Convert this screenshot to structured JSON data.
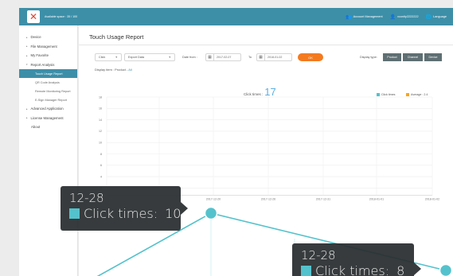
{
  "header": {
    "app_title": "Available space : 35 / 100",
    "account_management": "Account Management",
    "user": "vconity2222222",
    "language": "Language"
  },
  "sidebar": {
    "items": [
      {
        "label": "Device"
      },
      {
        "label": "File Management"
      },
      {
        "label": "My Favorite"
      },
      {
        "label": "Report Analysis"
      }
    ],
    "report_sub": [
      "Touch Usage Report",
      "QR Code Analysis",
      "Remote Monitoring Report",
      "E-Sign Manager Report"
    ],
    "items_after": [
      {
        "label": "Advanced Application"
      },
      {
        "label": "License Management"
      }
    ],
    "about": "About"
  },
  "main": {
    "title": "Touch Usage Report",
    "filter_type": "Click",
    "filter_data": "Export Data",
    "date_from_label": "Date from :",
    "date_from": "2017-02-07",
    "to_label": "To",
    "date_to": "2018-01-02",
    "ok_label": "OK",
    "display_type_label": "Display type:",
    "display_types": [
      "Product",
      "Channel",
      "Device"
    ],
    "display_item_label": "Display item : Product -",
    "display_item_value": "All",
    "click_times_label": "Click times :",
    "click_times_value": "17",
    "legend_click": "Click times",
    "legend_average": "Average : 2.4"
  },
  "chart_data": {
    "type": "line",
    "y_ticks": [
      "18",
      "16",
      "14",
      "12",
      "10",
      "8",
      "6",
      "4",
      "2"
    ],
    "x_ticks": [
      "2017-12-20",
      "2017-12-26",
      "2017-12-31",
      "2018-01-01",
      "2018-01-02"
    ],
    "ylim": [
      0,
      18
    ],
    "colors": {
      "click": "#54c2cc",
      "average": "#f5a623"
    }
  },
  "tooltips": [
    {
      "date": "12-28",
      "label": "Click times:",
      "value": "10"
    },
    {
      "date": "12-28",
      "label": "Click times:",
      "value": "8"
    }
  ]
}
